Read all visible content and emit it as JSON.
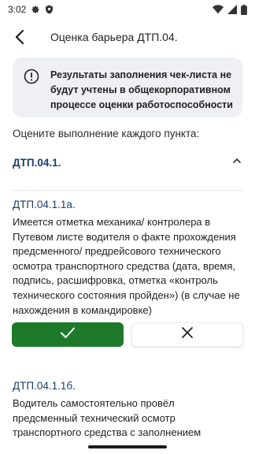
{
  "status_bar": {
    "time": "3:02",
    "icons": [
      "gear-icon",
      "shield-icon",
      "wifi-icon",
      "signal-icon",
      "battery-icon"
    ]
  },
  "app_bar": {
    "back_icon": "back-arrow-icon",
    "title": "Оценка барьера ДТП.04."
  },
  "notice": {
    "icon": "info-icon",
    "text": "Результаты заполнения чек-листа не будут учтены в общекорпоративном процессе оценки работоспособности"
  },
  "instruction": "Оцените выполнение каждого пункта:",
  "section": {
    "title": "ДТП.04.1.",
    "expanded": true
  },
  "items": [
    {
      "code": "ДТП.04.1.1а.",
      "text": "Имеется отметка механика/ контролера в Путевом листе водителя о факте прохождения предсменного/ предрейсового технического осмотра транспортного средства (дата, время, подпись, расшифровка, отметка «контроль технического состояния пройден») (в случае не нахождения в командировке)",
      "answer": "yes"
    },
    {
      "code": "ДТП.04.1.1б.",
      "text": "Водитель самостоятельно провёл предсменный технический осмотр транспортного средства с заполнением"
    }
  ],
  "colors": {
    "accent_green": "#1d7a2b",
    "title_blue": "#1f3d6b",
    "notice_bg": "#eef0f4"
  }
}
